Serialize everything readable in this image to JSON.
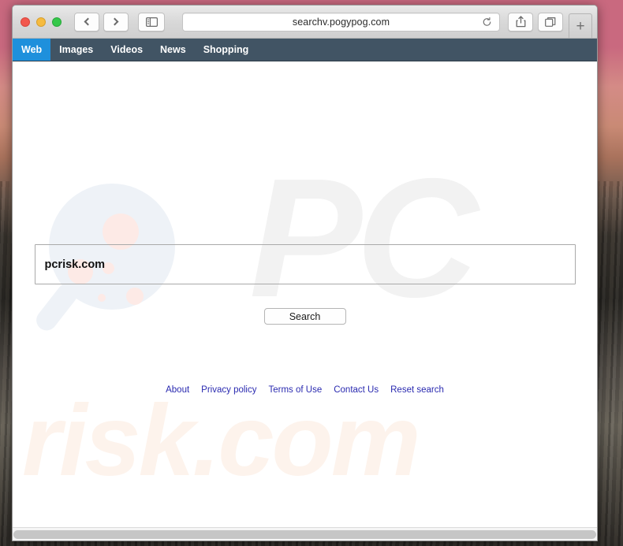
{
  "browser": {
    "window_controls": [
      {
        "name": "close",
        "color": "#f2574d"
      },
      {
        "name": "minimize",
        "color": "#f6bb3f"
      },
      {
        "name": "zoom",
        "color": "#35c84a"
      }
    ],
    "back_label": "Back",
    "forward_label": "Forward",
    "sidebar_label": "Show Sidebar",
    "address": {
      "url": "searchv.pogypog.com",
      "reload_label": "Reload"
    },
    "share_label": "Share",
    "tabs_overview_label": "Show Tab Overview",
    "new_tab_label": "+"
  },
  "site_nav": {
    "items": [
      {
        "label": "Web",
        "active": true
      },
      {
        "label": "Images",
        "active": false
      },
      {
        "label": "Videos",
        "active": false
      },
      {
        "label": "News",
        "active": false
      },
      {
        "label": "Shopping",
        "active": false
      }
    ],
    "bar_color": "#415464",
    "active_color": "#1e90dc"
  },
  "search": {
    "input_value": "pcrisk.com",
    "input_placeholder": "",
    "button_label": "Search"
  },
  "footer": {
    "links": [
      {
        "label": "About"
      },
      {
        "label": "Privacy policy"
      },
      {
        "label": "Terms of Use"
      },
      {
        "label": "Contact Us"
      },
      {
        "label": "Reset search"
      }
    ],
    "link_color": "#2a2ab0"
  },
  "watermark": {
    "pc_text": "PC",
    "risk_text": "risk.com",
    "magnifier_color": "#eef2f7",
    "dot_color": "#fdeae6",
    "pc_color": "#f2f2f2",
    "risk_color": "#fdf3ec"
  }
}
